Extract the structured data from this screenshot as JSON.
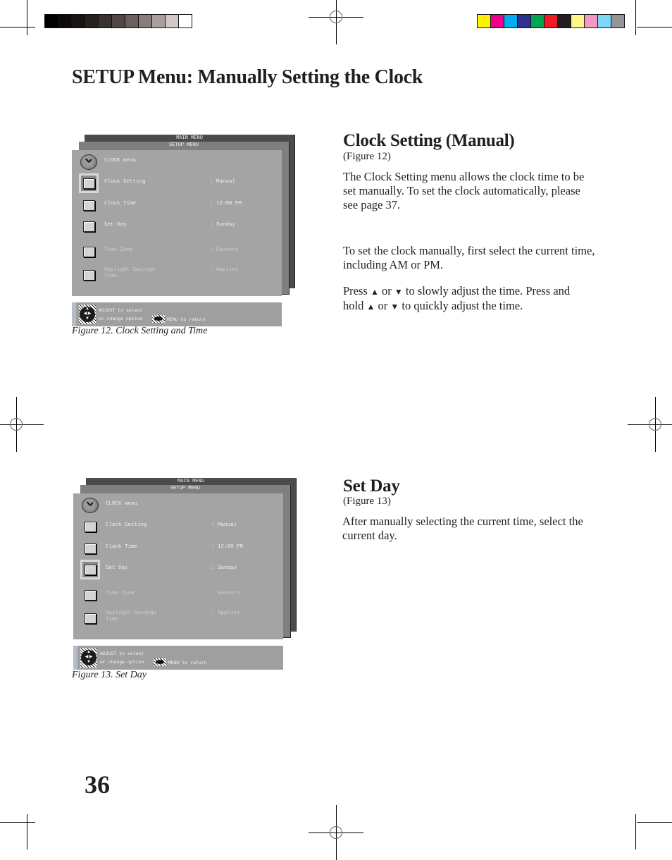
{
  "page": {
    "title": "SETUP Menu: Manually Setting the Clock",
    "page_number": "36"
  },
  "print_marks": {
    "grayscale_swatches": [
      "#000000",
      "#0b0a09",
      "#171413",
      "#25211f",
      "#3a3230",
      "#514845",
      "#6a605d",
      "#877e7b",
      "#a9a09e",
      "#d0c9c8",
      "#ffffff"
    ],
    "color_swatches": [
      "#fff200",
      "#ec008c",
      "#00aeef",
      "#2e3192",
      "#00a651",
      "#ed1c24",
      "#231f20",
      "#fff685",
      "#f49ac1",
      "#7fd6f7",
      "#939598"
    ]
  },
  "sections": [
    {
      "title": "Clock Setting (Manual)",
      "figure_ref": "(Figure 12)",
      "paragraphs": [
        "The Clock Setting menu allows the clock time to be set manually.  To set the clock automatically, please see page 37.",
        "To set the clock manually, first select the current time, including AM or PM."
      ],
      "press_text": {
        "p1": "Press",
        "or1": "or",
        "mid": "to slowly adjust the time.  Press and hold",
        "or2": "or",
        "end": "to quickly adjust the time.",
        "up_symbol": "▲",
        "down_symbol": "▼"
      }
    },
    {
      "title": "Set Day",
      "figure_ref": "(Figure 13)",
      "paragraphs": [
        "After manually selecting the current time, select the current day."
      ]
    }
  ],
  "figures": [
    {
      "caption": "Figure 12.  Clock Setting and Time",
      "main_menu_label": "MAIN MENU",
      "setup_menu_label": "SETUP MENU",
      "header": "CLOCK menu",
      "selected_index": 0,
      "rows": [
        {
          "label": "Clock Setting",
          "value": ": Manual"
        },
        {
          "label": "Clock Time",
          "value": ": 12:00 PM"
        },
        {
          "label": "Set Day",
          "value": ": Sunday"
        },
        {
          "label": "Time Zone",
          "value": ": Eastern"
        },
        {
          "label": "Daylight Savings",
          "label2": "Time",
          "value": ": Applies"
        }
      ],
      "help": {
        "line1": "ADJUST to select",
        "line2": "or  change  option",
        "menu": "MENU  to  return"
      }
    },
    {
      "caption": "Figure 13.  Set Day",
      "main_menu_label": "MAIN MENU",
      "setup_menu_label": "SETUP MENU",
      "header": "CLOCK menu",
      "selected_index": 2,
      "rows": [
        {
          "label": "Clock Setting",
          "value": ": Manual"
        },
        {
          "label": "Clock Time",
          "value": ": 12:00 PM"
        },
        {
          "label": "Set Day",
          "value": ": Sunday"
        },
        {
          "label": "Time Zone",
          "value": ": Eastern"
        },
        {
          "label": "Daylight Savings",
          "label2": "Time",
          "value": ": Applies"
        }
      ],
      "help": {
        "line1": "ADJUST to select",
        "line2": "or  change  option",
        "menu": "MENU  to  return"
      }
    }
  ]
}
